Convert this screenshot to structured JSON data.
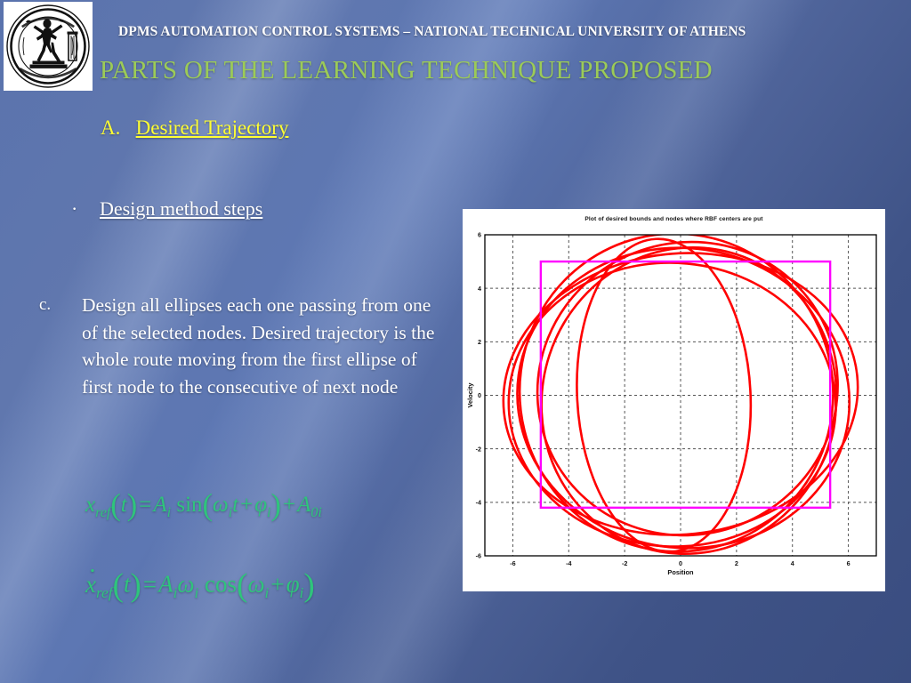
{
  "header": {
    "title": "DPMS AUTOMATION CONTROL SYSTEMS – NATIONAL TECHNICAL UNIVERSITY OF ATHENS",
    "logo_alt": "ntua-seal-logo"
  },
  "slide": {
    "title": "PARTS OF THE LEARNING TECHNIQUE PROPOSED",
    "section_label": "A.",
    "section_text": "Desired Trajectory",
    "bullet_text": "Design method steps ",
    "item_marker": "c.",
    "item_text": "Design all ellipses each one passing from one of the selected nodes. Desired trajectory is the whole route moving from the first ellipse of first node to the consecutive of next node"
  },
  "equations": {
    "eq1": {
      "lhs_var": "x",
      "lhs_sub": "ref",
      "arg": "t",
      "equals": "=",
      "amp": "A",
      "amp_sub": "i",
      "fn": "sin",
      "omega": "ω",
      "omega_sub": "i",
      "time": "t",
      "plus": "+",
      "phi": "φ",
      "phi_sub": "i",
      "offset": "A",
      "offset_sub": "0i"
    },
    "eq2": {
      "lhs_var": "x",
      "lhs_sub": "ref",
      "arg": "t",
      "equals": "=",
      "amp": "A",
      "amp_sub": "i",
      "omega": "ω",
      "omega_sub": "i",
      "fn": "cos",
      "omega2": "ω",
      "omega2_sub": "i",
      "plus": "+",
      "phi": "φ",
      "phi_sub": "i"
    }
  },
  "colors": {
    "title_green": "#9ccb57",
    "section_yellow": "#ffff33",
    "equation_green": "#2fc47c",
    "ellipse_red": "#ff0000",
    "bounds_magenta": "#ff00ff",
    "background_blue": "#5a73ad"
  },
  "chart_data": {
    "type": "line",
    "title": "Plot of desired bounds and nodes where RBF centers are put",
    "xlabel": "Position",
    "ylabel": "Velocity",
    "xlim": [
      -7,
      7
    ],
    "ylim": [
      -6,
      6
    ],
    "xticks": [
      -6,
      -4,
      -2,
      0,
      2,
      4,
      6
    ],
    "yticks": [
      -6,
      -4,
      -2,
      0,
      2,
      4,
      6
    ],
    "grid": true,
    "legend": "none",
    "series": [
      {
        "name": "ellipse-1",
        "color": "#ff0000",
        "type": "ellipse",
        "cx": 0.0,
        "cy": 0.05,
        "rx": 6.35,
        "ry": 5.25,
        "rotation": -6
      },
      {
        "name": "ellipse-2",
        "color": "#ff0000",
        "type": "ellipse",
        "cx": 0.1,
        "cy": -0.1,
        "rx": 5.95,
        "ry": 5.6,
        "rotation": 8
      },
      {
        "name": "ellipse-3",
        "color": "#ff0000",
        "type": "ellipse",
        "cx": -0.15,
        "cy": 0.1,
        "rx": 5.6,
        "ry": 5.95,
        "rotation": -14
      },
      {
        "name": "ellipse-4",
        "color": "#ff0000",
        "type": "ellipse",
        "cx": 0.3,
        "cy": -0.2,
        "rx": 5.25,
        "ry": 5.75,
        "rotation": 18
      },
      {
        "name": "ellipse-5",
        "color": "#ff0000",
        "type": "ellipse",
        "cx": -0.6,
        "cy": 0.0,
        "rx": 3.1,
        "ry": 5.85,
        "rotation": -3
      },
      {
        "name": "ellipse-6",
        "color": "#ff0000",
        "type": "ellipse",
        "cx": -0.3,
        "cy": -0.35,
        "rx": 5.85,
        "ry": 5.3,
        "rotation": 3
      },
      {
        "name": "ellipse-7",
        "color": "#ff0000",
        "type": "ellipse",
        "cx": 0.25,
        "cy": 0.25,
        "rx": 5.4,
        "ry": 5.45,
        "rotation": -24
      }
    ],
    "bounds_rect": {
      "name": "desired-bounds",
      "color": "#ff00ff",
      "x0": -5.0,
      "y0": -4.2,
      "x1": 5.35,
      "y1": 5.0
    }
  }
}
